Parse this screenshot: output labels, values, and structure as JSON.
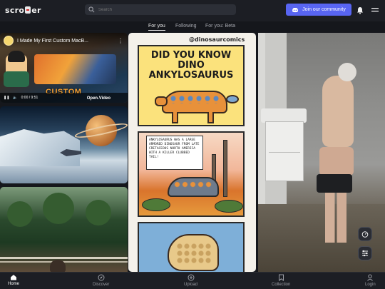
{
  "app": {
    "logo_prefix": "scro",
    "logo_suffix": "er"
  },
  "search": {
    "placeholder": "Search"
  },
  "header": {
    "community_button": "Join our community"
  },
  "tabs": [
    {
      "label": "For you",
      "active": true
    },
    {
      "label": "Following",
      "active": false
    },
    {
      "label": "For you: Beta",
      "active": false
    }
  ],
  "video": {
    "title": "I Made My First Custom MacB...",
    "caption": "CUSTOM",
    "time": "0:00 / 9:51",
    "branding": "Open.Video"
  },
  "comic": {
    "handle": "@dinosaurcomics",
    "headline_line1": "DID YOU KNOW DINO",
    "headline_line2": "ANKYLOSAURUS",
    "fact_text": "ANKYLOSAURUS WAS A LARGE ARMORED DINOSAUR FROM LATE CRETACEOUS NORTH AMERICA WITH A KILLER CLUBBED TAIL!"
  },
  "bottom_nav": [
    {
      "label": "Home",
      "icon": "home-icon",
      "active": true
    },
    {
      "label": "Discover",
      "icon": "compass-icon",
      "active": false
    },
    {
      "label": "Upload",
      "icon": "plus-circle-icon",
      "active": false
    },
    {
      "label": "Collection",
      "icon": "bookmark-icon",
      "active": false
    },
    {
      "label": "Login",
      "icon": "user-icon",
      "active": false
    }
  ],
  "colors": {
    "accent": "#5865f2",
    "background": "#15171c",
    "bar": "#1c1e24"
  }
}
